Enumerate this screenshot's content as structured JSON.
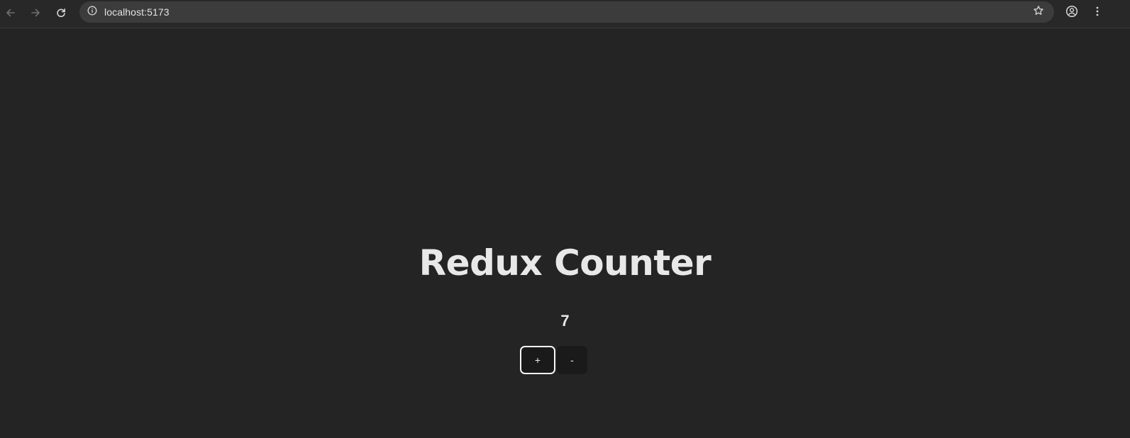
{
  "browser": {
    "url": "localhost:5173",
    "icons": {
      "back": "arrow-left-icon",
      "forward": "arrow-right-icon",
      "reload": "reload-icon",
      "site_info": "info-circle-icon",
      "bookmark": "star-icon",
      "profile": "account-circle-icon",
      "menu": "more-vert-icon"
    }
  },
  "app": {
    "title": "Redux Counter",
    "count": "7",
    "increment_label": "+",
    "decrement_label": "-"
  },
  "colors": {
    "page_background": "#242424",
    "toolbar_background": "#282828",
    "omnibox_background": "#3c3c3c",
    "text": "#e8e8e8",
    "button_background": "#1a1a1a",
    "focused_button_border": "#f5f5f5"
  }
}
